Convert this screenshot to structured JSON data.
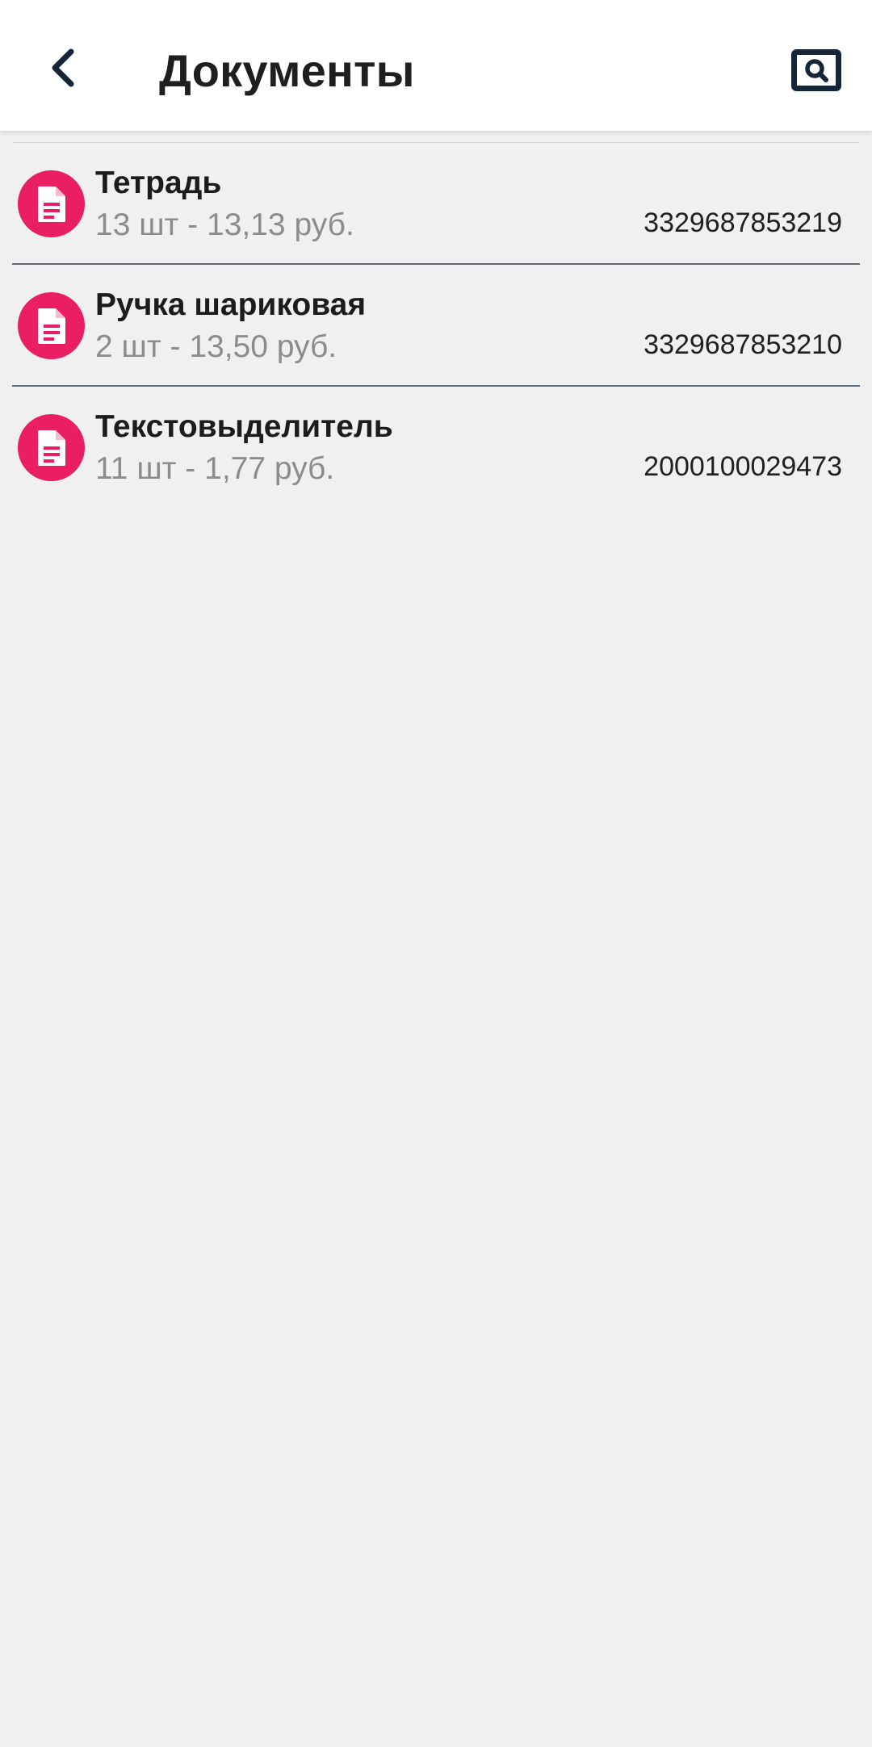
{
  "header": {
    "title": "Документы",
    "back_icon": "chevron-left-icon",
    "search_icon": "search-icon"
  },
  "colors": {
    "accent": "#e91e63",
    "appbar_icon": "#152638",
    "divider": "#5e6f7f",
    "background": "#f0f0f0"
  },
  "items": [
    {
      "name": "Тетрадь",
      "details": "13 шт - 13,13 руб.",
      "code": "3329687853219",
      "icon": "document-icon"
    },
    {
      "name": "Ручка шариковая",
      "details": "2 шт - 13,50 руб.",
      "code": "3329687853210",
      "icon": "document-icon"
    },
    {
      "name": "Текстовыделитель",
      "details": "11 шт - 1,77 руб.",
      "code": "2000100029473",
      "icon": "document-icon"
    }
  ]
}
